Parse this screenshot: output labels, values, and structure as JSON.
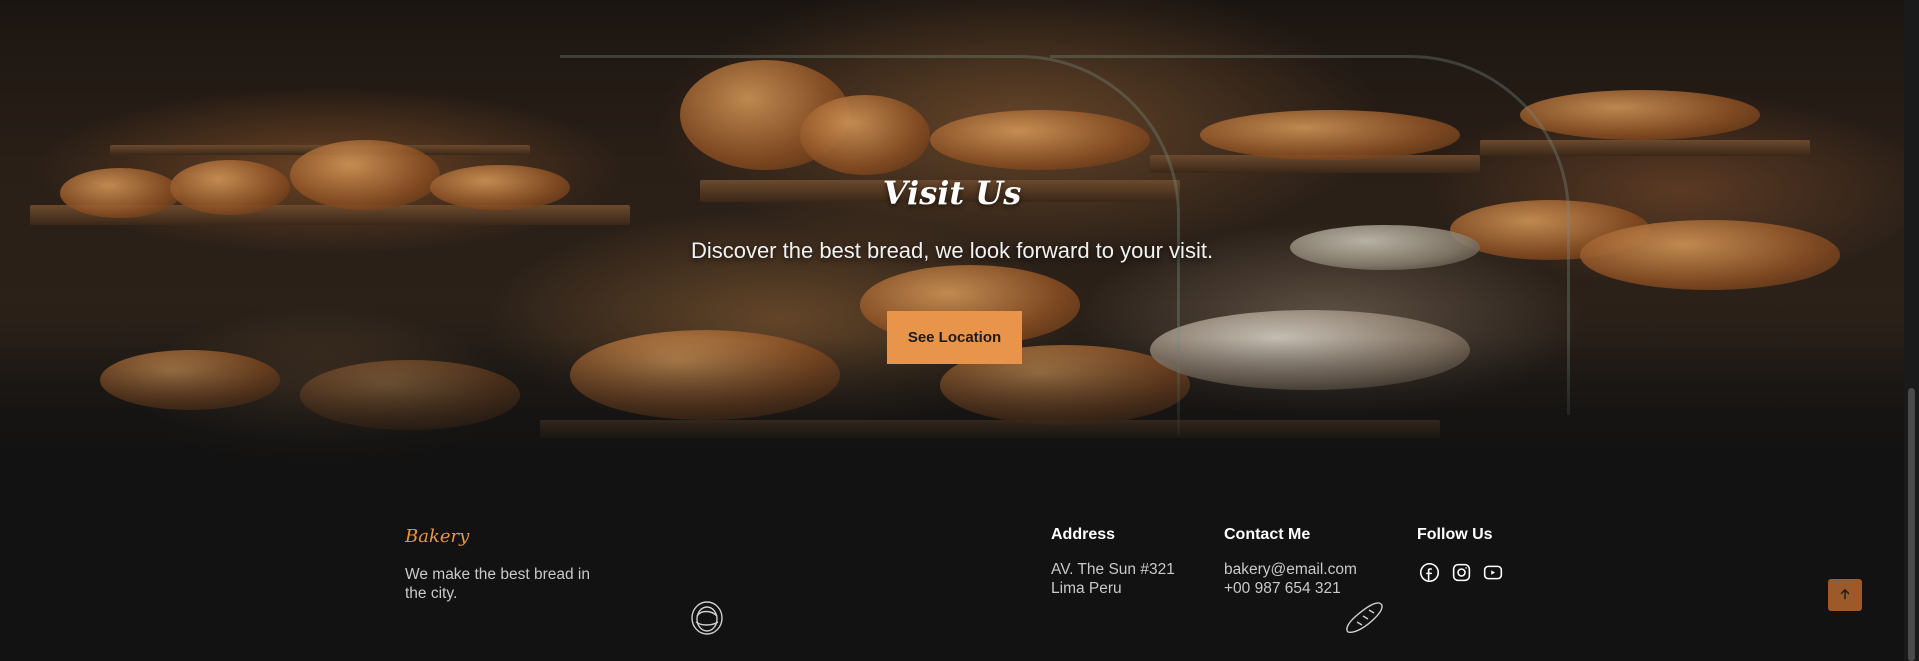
{
  "hero": {
    "title": "Visit Us",
    "subtitle": "Discover the best bread, we look forward to your visit.",
    "button_label": "See Location"
  },
  "footer": {
    "brand": "Bakery",
    "tagline": "We make the best bread in the city.",
    "address": {
      "title": "Address",
      "line1": "AV. The Sun #321",
      "line2": "Lima Peru"
    },
    "contact": {
      "title": "Contact Me",
      "email": "bakery@email.com",
      "phone": "+00 987 654 321"
    },
    "follow": {
      "title": "Follow Us",
      "icons": [
        "facebook-icon",
        "instagram-icon",
        "youtube-icon"
      ]
    },
    "back_to_top_icon": "arrow-up-icon"
  },
  "colors": {
    "accent": "#e8944a",
    "back_to_top": "#9c5a2a",
    "background": "#121212"
  }
}
